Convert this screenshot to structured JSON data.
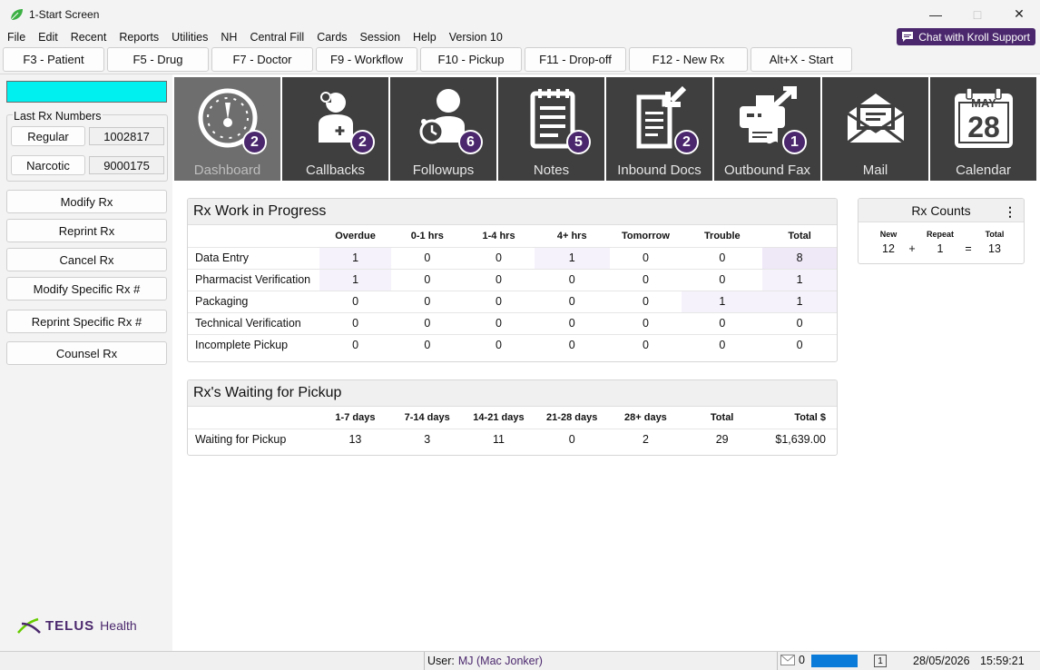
{
  "window": {
    "title": "1-Start Screen"
  },
  "menu": [
    "File",
    "Edit",
    "Recent",
    "Reports",
    "Utilities",
    "NH",
    "Central Fill",
    "Cards",
    "Session",
    "Help",
    "Version 10"
  ],
  "chat_button": "Chat with Kroll Support",
  "fkeys": [
    "F3 - Patient",
    "F5 - Drug",
    "F7 - Doctor",
    "F9 - Workflow",
    "F10 - Pickup",
    "F11 - Drop-off",
    "F12 - New Rx",
    "Alt+X - Start"
  ],
  "left": {
    "search_value": "",
    "last_rx_title": "Last Rx Numbers",
    "regular_label": "Regular",
    "regular_value": "1002817",
    "narcotic_label": "Narcotic",
    "narcotic_value": "9000175",
    "actions": [
      "Modify Rx",
      "Reprint Rx",
      "Cancel Rx",
      "Modify Specific Rx #",
      "Reprint Specific Rx #",
      "Counsel Rx"
    ],
    "logo_brand": "TELUS",
    "logo_health": "Health"
  },
  "tiles": [
    {
      "label": "Dashboard",
      "badge": "2",
      "icon": "dashboard-gauge-icon"
    },
    {
      "label": "Callbacks",
      "badge": "2",
      "icon": "doctor-icon"
    },
    {
      "label": "Followups",
      "badge": "6",
      "icon": "person-alarm-icon"
    },
    {
      "label": "Notes",
      "badge": "5",
      "icon": "notepad-icon"
    },
    {
      "label": "Inbound Docs",
      "badge": "2",
      "icon": "inbound-document-icon"
    },
    {
      "label": "Outbound Fax",
      "badge": "1",
      "icon": "fax-icon"
    },
    {
      "label": "Mail",
      "badge": "",
      "icon": "mail-envelope-icon"
    },
    {
      "label": "Calendar",
      "badge": "",
      "icon": "calendar-icon",
      "month": "MAY",
      "day": "28"
    }
  ],
  "wip": {
    "title": "Rx Work in Progress",
    "columns": [
      "Overdue",
      "0-1 hrs",
      "1-4 hrs",
      "4+ hrs",
      "Tomorrow",
      "Trouble",
      "Total"
    ],
    "rows": [
      {
        "label": "Data Entry",
        "values": [
          "1",
          "0",
          "0",
          "1",
          "0",
          "0",
          "8"
        ]
      },
      {
        "label": "Pharmacist Verification",
        "values": [
          "1",
          "0",
          "0",
          "0",
          "0",
          "0",
          "1"
        ]
      },
      {
        "label": "Packaging",
        "values": [
          "0",
          "0",
          "0",
          "0",
          "0",
          "1",
          "1"
        ]
      },
      {
        "label": "Technical Verification",
        "values": [
          "0",
          "0",
          "0",
          "0",
          "0",
          "0",
          "0"
        ]
      },
      {
        "label": "Incomplete Pickup",
        "values": [
          "0",
          "0",
          "0",
          "0",
          "0",
          "0",
          "0"
        ]
      }
    ]
  },
  "pickup": {
    "title": "Rx's Waiting for Pickup",
    "columns": [
      "1-7 days",
      "7-14 days",
      "14-21 days",
      "21-28 days",
      "28+ days",
      "Total",
      "Total $"
    ],
    "rows": [
      {
        "label": "Waiting for Pickup",
        "values": [
          "13",
          "3",
          "11",
          "0",
          "2",
          "29",
          "$1,639.00"
        ]
      }
    ]
  },
  "counts": {
    "title": "Rx Counts",
    "new_label": "New",
    "new_value": "12",
    "plus": "+",
    "repeat_label": "Repeat",
    "repeat_value": "1",
    "equals": "=",
    "total_label": "Total",
    "total_value": "13"
  },
  "status": {
    "user_label": "User:",
    "user_value": "MJ (Mac Jonker)",
    "mail_count": "0",
    "box_value": "1",
    "date": "28/05/2026",
    "time": "15:59:21"
  },
  "colors": {
    "brand": "#4b286d",
    "search_bg": "#00f0f0",
    "tile_bg": "#3f3f3f",
    "tile_active_bg": "#6e6e6e",
    "progress": "#0a7bd8"
  }
}
